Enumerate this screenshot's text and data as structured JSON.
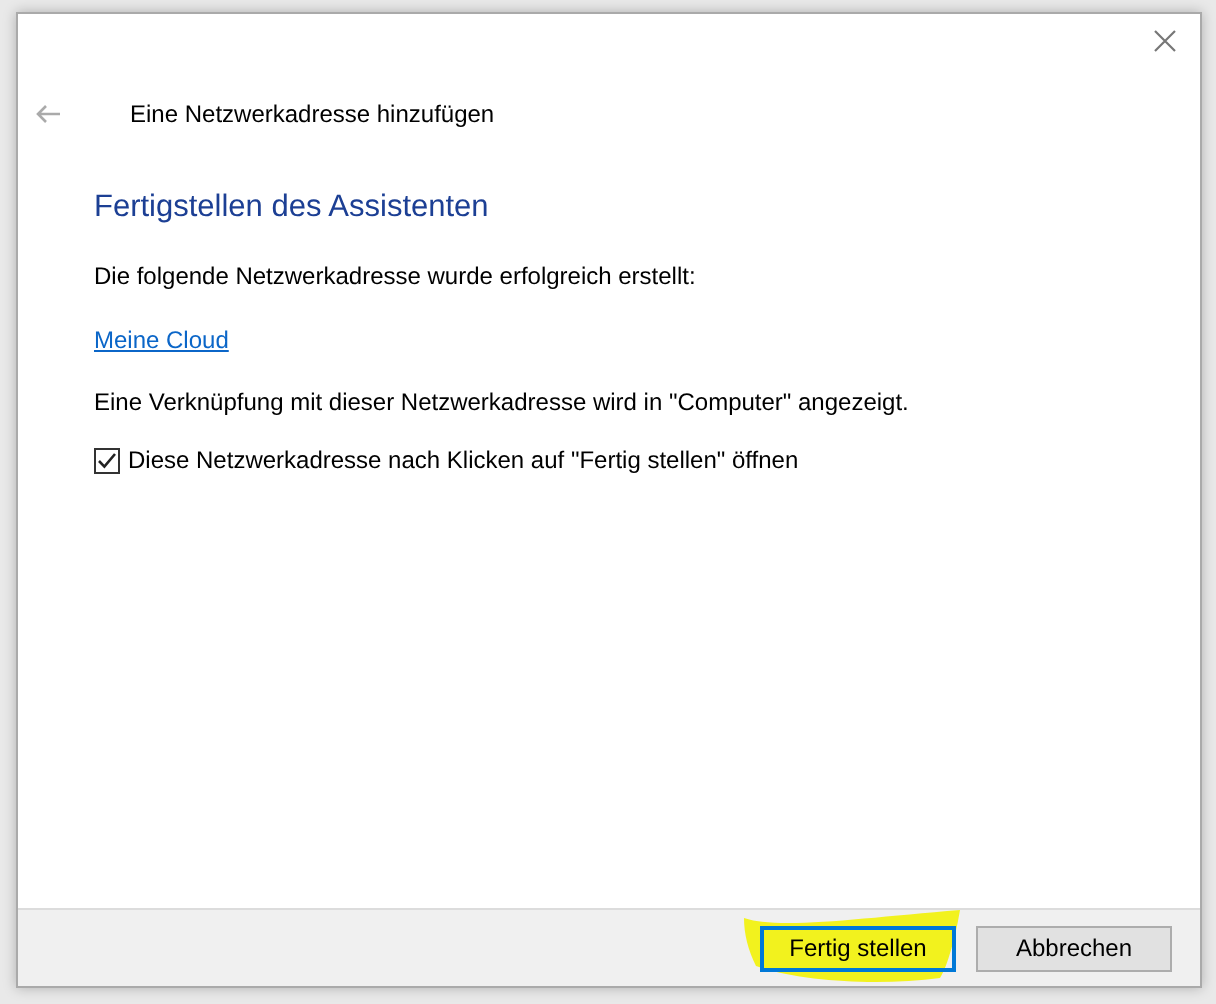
{
  "dialog": {
    "title": "Eine Netzwerkadresse hinzufügen",
    "heading": "Fertigstellen des Assistenten",
    "intro": "Die folgende Netzwerkadresse wurde erfolgreich erstellt:",
    "link": "Meine Cloud",
    "note": "Eine Verknüpfung mit dieser Netzwerkadresse wird in \"Computer\" angezeigt.",
    "checkbox": {
      "label": "Diese Netzwerkadresse nach Klicken auf \"Fertig stellen\" öffnen",
      "checked": true
    }
  },
  "buttons": [
    {
      "label": "Fertig stellen",
      "default": true,
      "highlighted": true
    },
    {
      "label": "Abbrechen",
      "default": false,
      "highlighted": false
    }
  ]
}
